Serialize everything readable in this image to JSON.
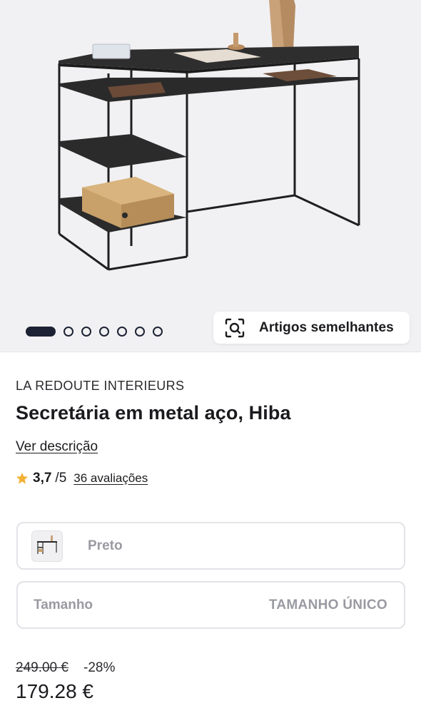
{
  "gallery": {
    "image_count": 7,
    "active_index": 0,
    "similar_button_label": "Artigos semelhantes"
  },
  "product": {
    "brand": "LA REDOUTE INTERIEURS",
    "title": "Secretária em metal aço, Hiba",
    "description_link": "Ver descrição"
  },
  "rating": {
    "score": "3,7",
    "max": "/5",
    "reviews_link": "36 avaliações",
    "star_color": "#f2b134"
  },
  "selectors": {
    "color_value": "Preto",
    "size_label": "Tamanho",
    "size_value": "TAMANHO ÚNICO"
  },
  "price": {
    "old": "249.00 €",
    "discount": "-28%",
    "current": "179.28 €"
  },
  "colors": {
    "text_primary": "#1b1b1f",
    "muted": "#9a9aa2",
    "dot_active": "#1c2233",
    "border": "#e3e3e8"
  }
}
